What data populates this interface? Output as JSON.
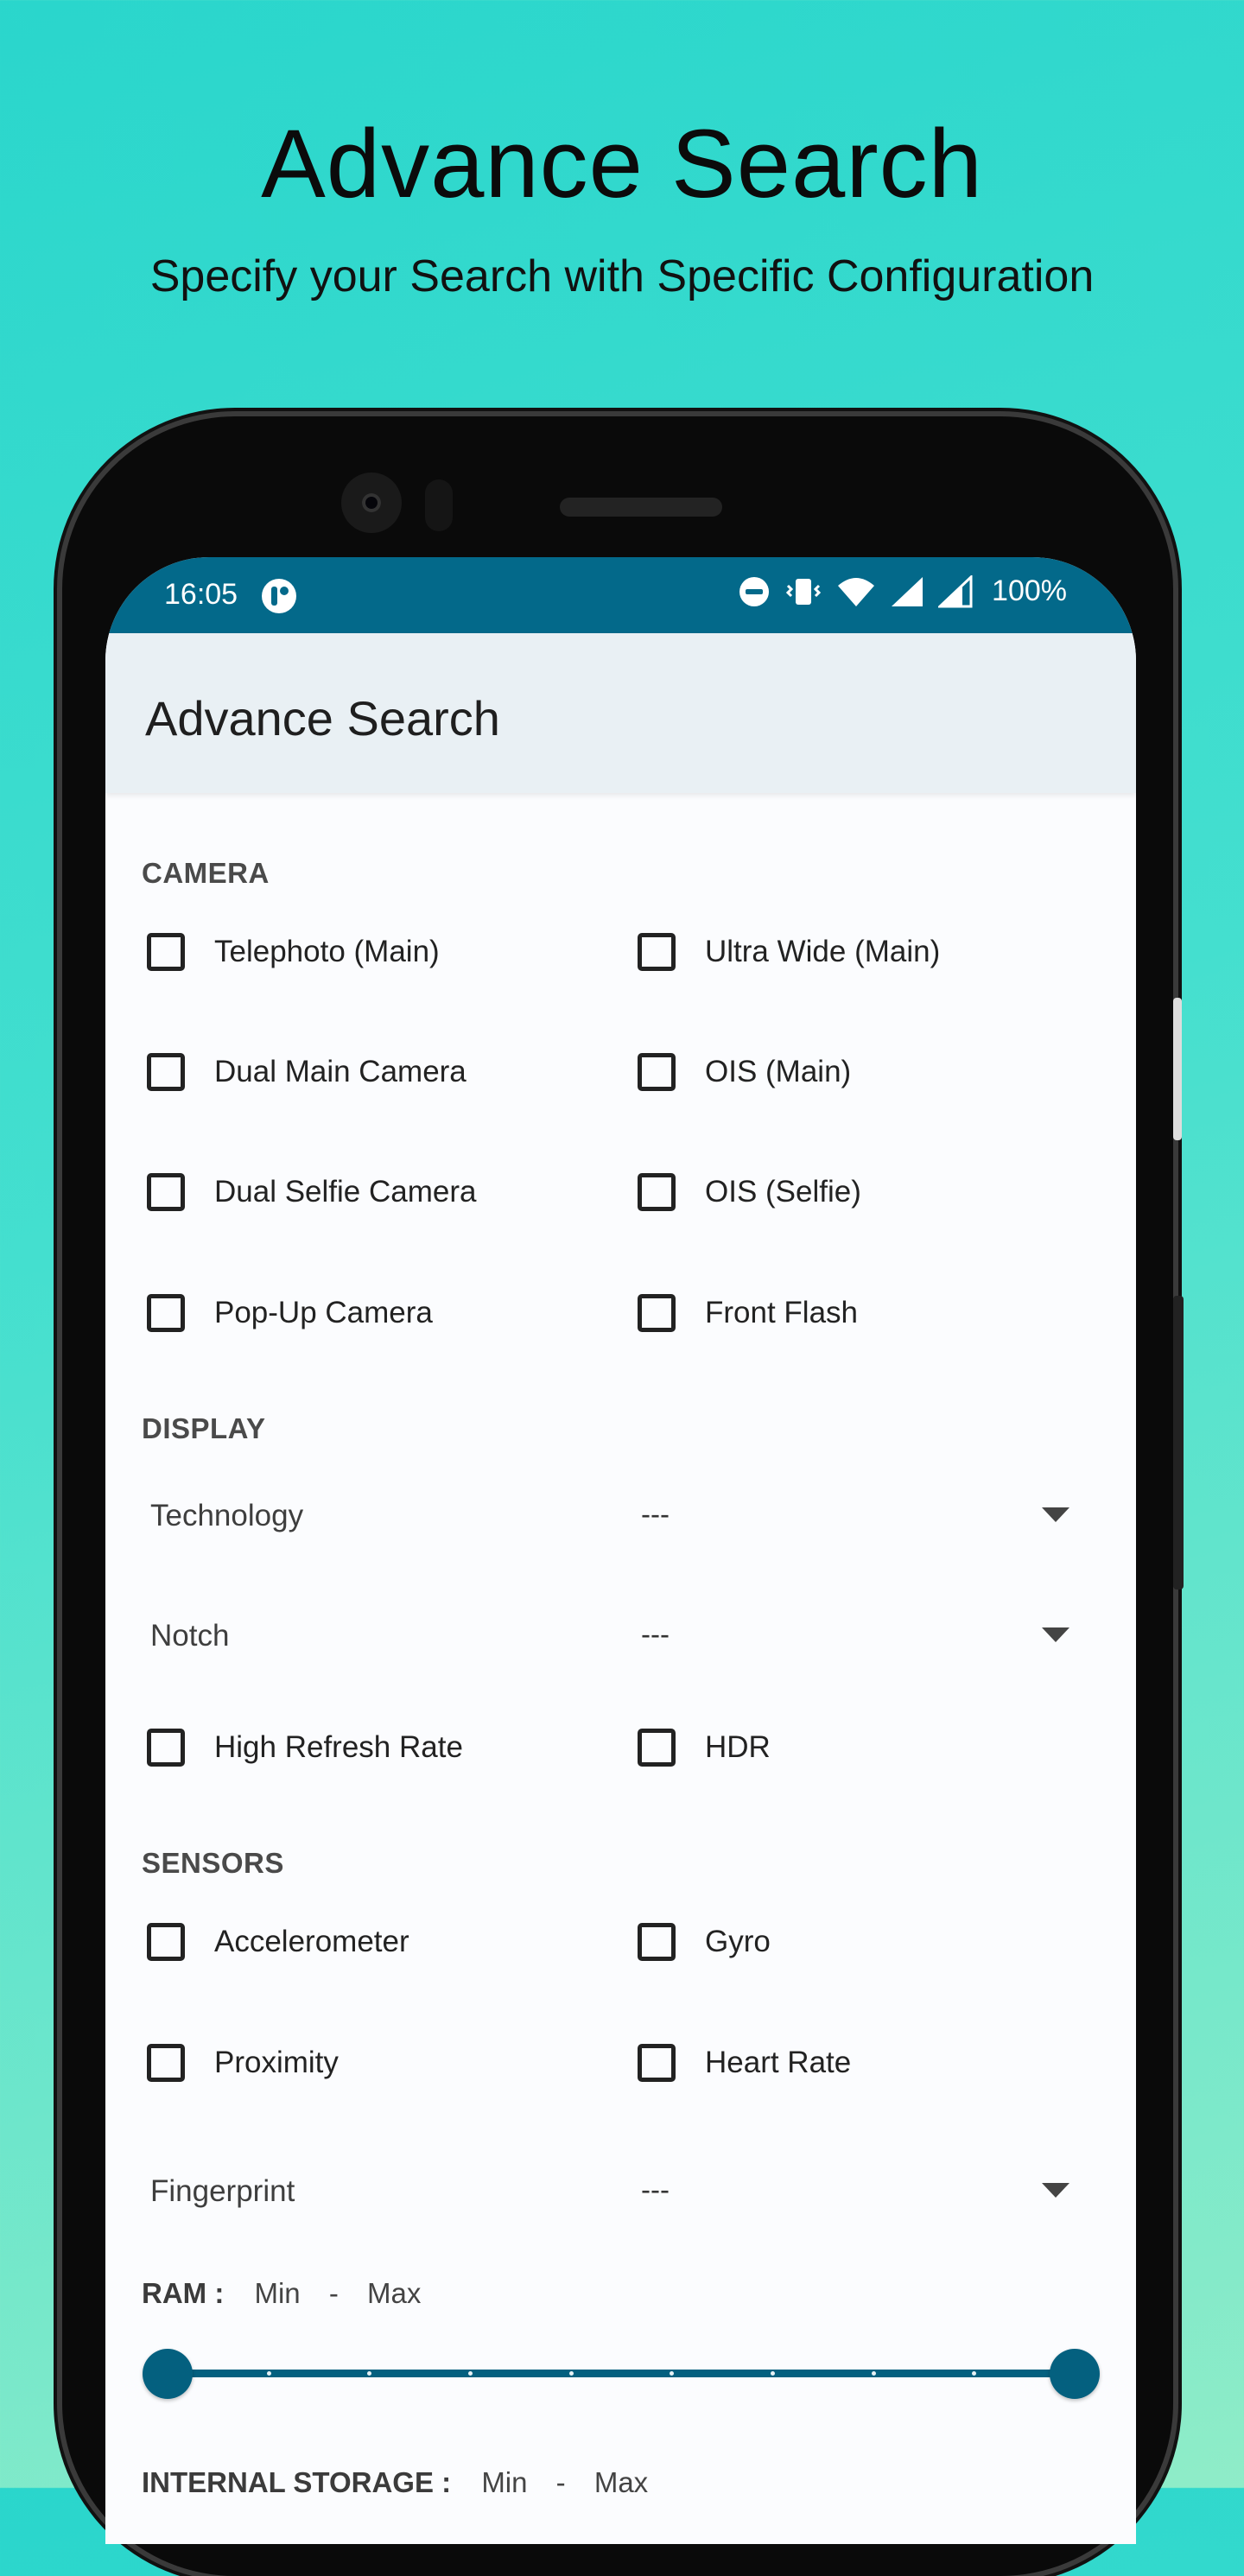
{
  "promo": {
    "title": "Advance Search",
    "subtitle": "Specify your Search with Specific Configuration"
  },
  "status_bar": {
    "time": "16:05",
    "battery": "100%",
    "icons": [
      "app-notification-icon",
      "do-not-disturb-icon",
      "vibrate-icon",
      "wifi-icon",
      "signal-icon",
      "signal-icon"
    ]
  },
  "app_bar": {
    "title": "Advance Search"
  },
  "camera": {
    "heading": "CAMERA",
    "options": [
      "Telephoto (Main)",
      "Ultra Wide (Main)",
      "Dual Main Camera",
      "OIS (Main)",
      "Dual Selfie Camera",
      "OIS (Selfie)",
      "Pop-Up Camera",
      "Front Flash"
    ]
  },
  "display": {
    "heading": "DISPLAY",
    "technology": {
      "label": "Technology",
      "value": "---"
    },
    "notch": {
      "label": "Notch",
      "value": "---"
    },
    "options": [
      "High Refresh Rate",
      "HDR"
    ]
  },
  "sensors": {
    "heading": "SENSORS",
    "options": [
      "Accelerometer",
      "Gyro",
      "Proximity",
      "Heart Rate"
    ],
    "fingerprint": {
      "label": "Fingerprint",
      "value": "---"
    }
  },
  "ram": {
    "label": "RAM :",
    "min": "Min",
    "sep": "-",
    "max": "Max",
    "range": [
      0,
      1
    ]
  },
  "storage": {
    "label": "INTERNAL STORAGE :",
    "min": "Min",
    "sep": "-",
    "max": "Max"
  },
  "colors": {
    "accent": "#04607f",
    "status_bar": "#03698a",
    "app_bar": "#e9f0f4"
  }
}
